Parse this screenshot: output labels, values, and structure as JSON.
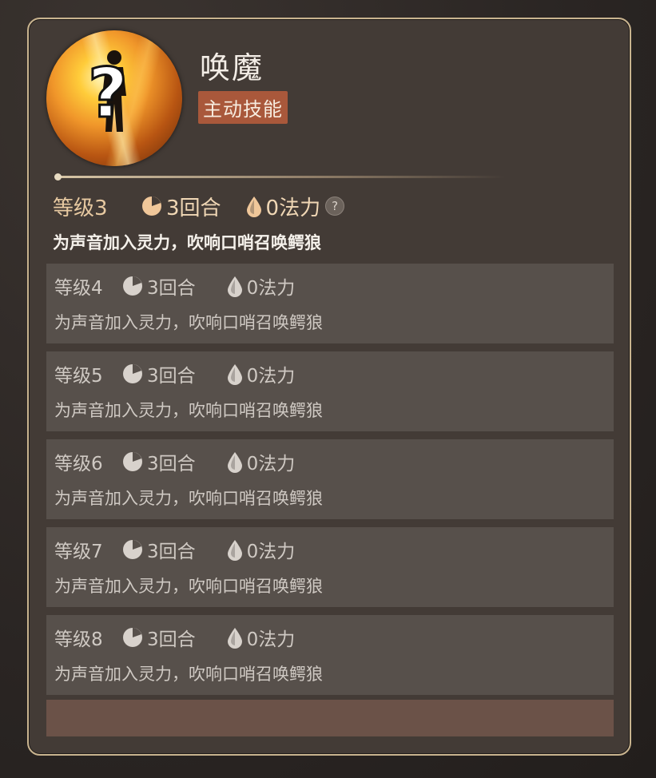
{
  "skill": {
    "name": "唤魔",
    "type": "主动技能",
    "icon": "unknown-summon-skill-icon"
  },
  "current": {
    "level": "等级3",
    "rounds": "3回合",
    "mana": "0法力",
    "description": "为声音加入灵力，吹响口哨召唤鳄狼",
    "help_icon": "?"
  },
  "levels": [
    {
      "level": "等级4",
      "rounds": "3回合",
      "mana": "0法力",
      "description": "为声音加入灵力，吹响口哨召唤鳄狼"
    },
    {
      "level": "等级5",
      "rounds": "3回合",
      "mana": "0法力",
      "description": "为声音加入灵力，吹响口哨召唤鳄狼"
    },
    {
      "level": "等级6",
      "rounds": "3回合",
      "mana": "0法力",
      "description": "为声音加入灵力，吹响口哨召唤鳄狼"
    },
    {
      "level": "等级7",
      "rounds": "3回合",
      "mana": "0法力",
      "description": "为声音加入灵力，吹响口哨召唤鳄狼"
    },
    {
      "level": "等级8",
      "rounds": "3回合",
      "mana": "0法力",
      "description": "为声音加入灵力，吹响口哨召唤鳄狼"
    }
  ],
  "colors": {
    "border": "#c9b48f",
    "panel": "#433b36",
    "type_badge": "#a9583b",
    "current_stat": "#f0d7b5",
    "locked_block": "#57504b"
  }
}
